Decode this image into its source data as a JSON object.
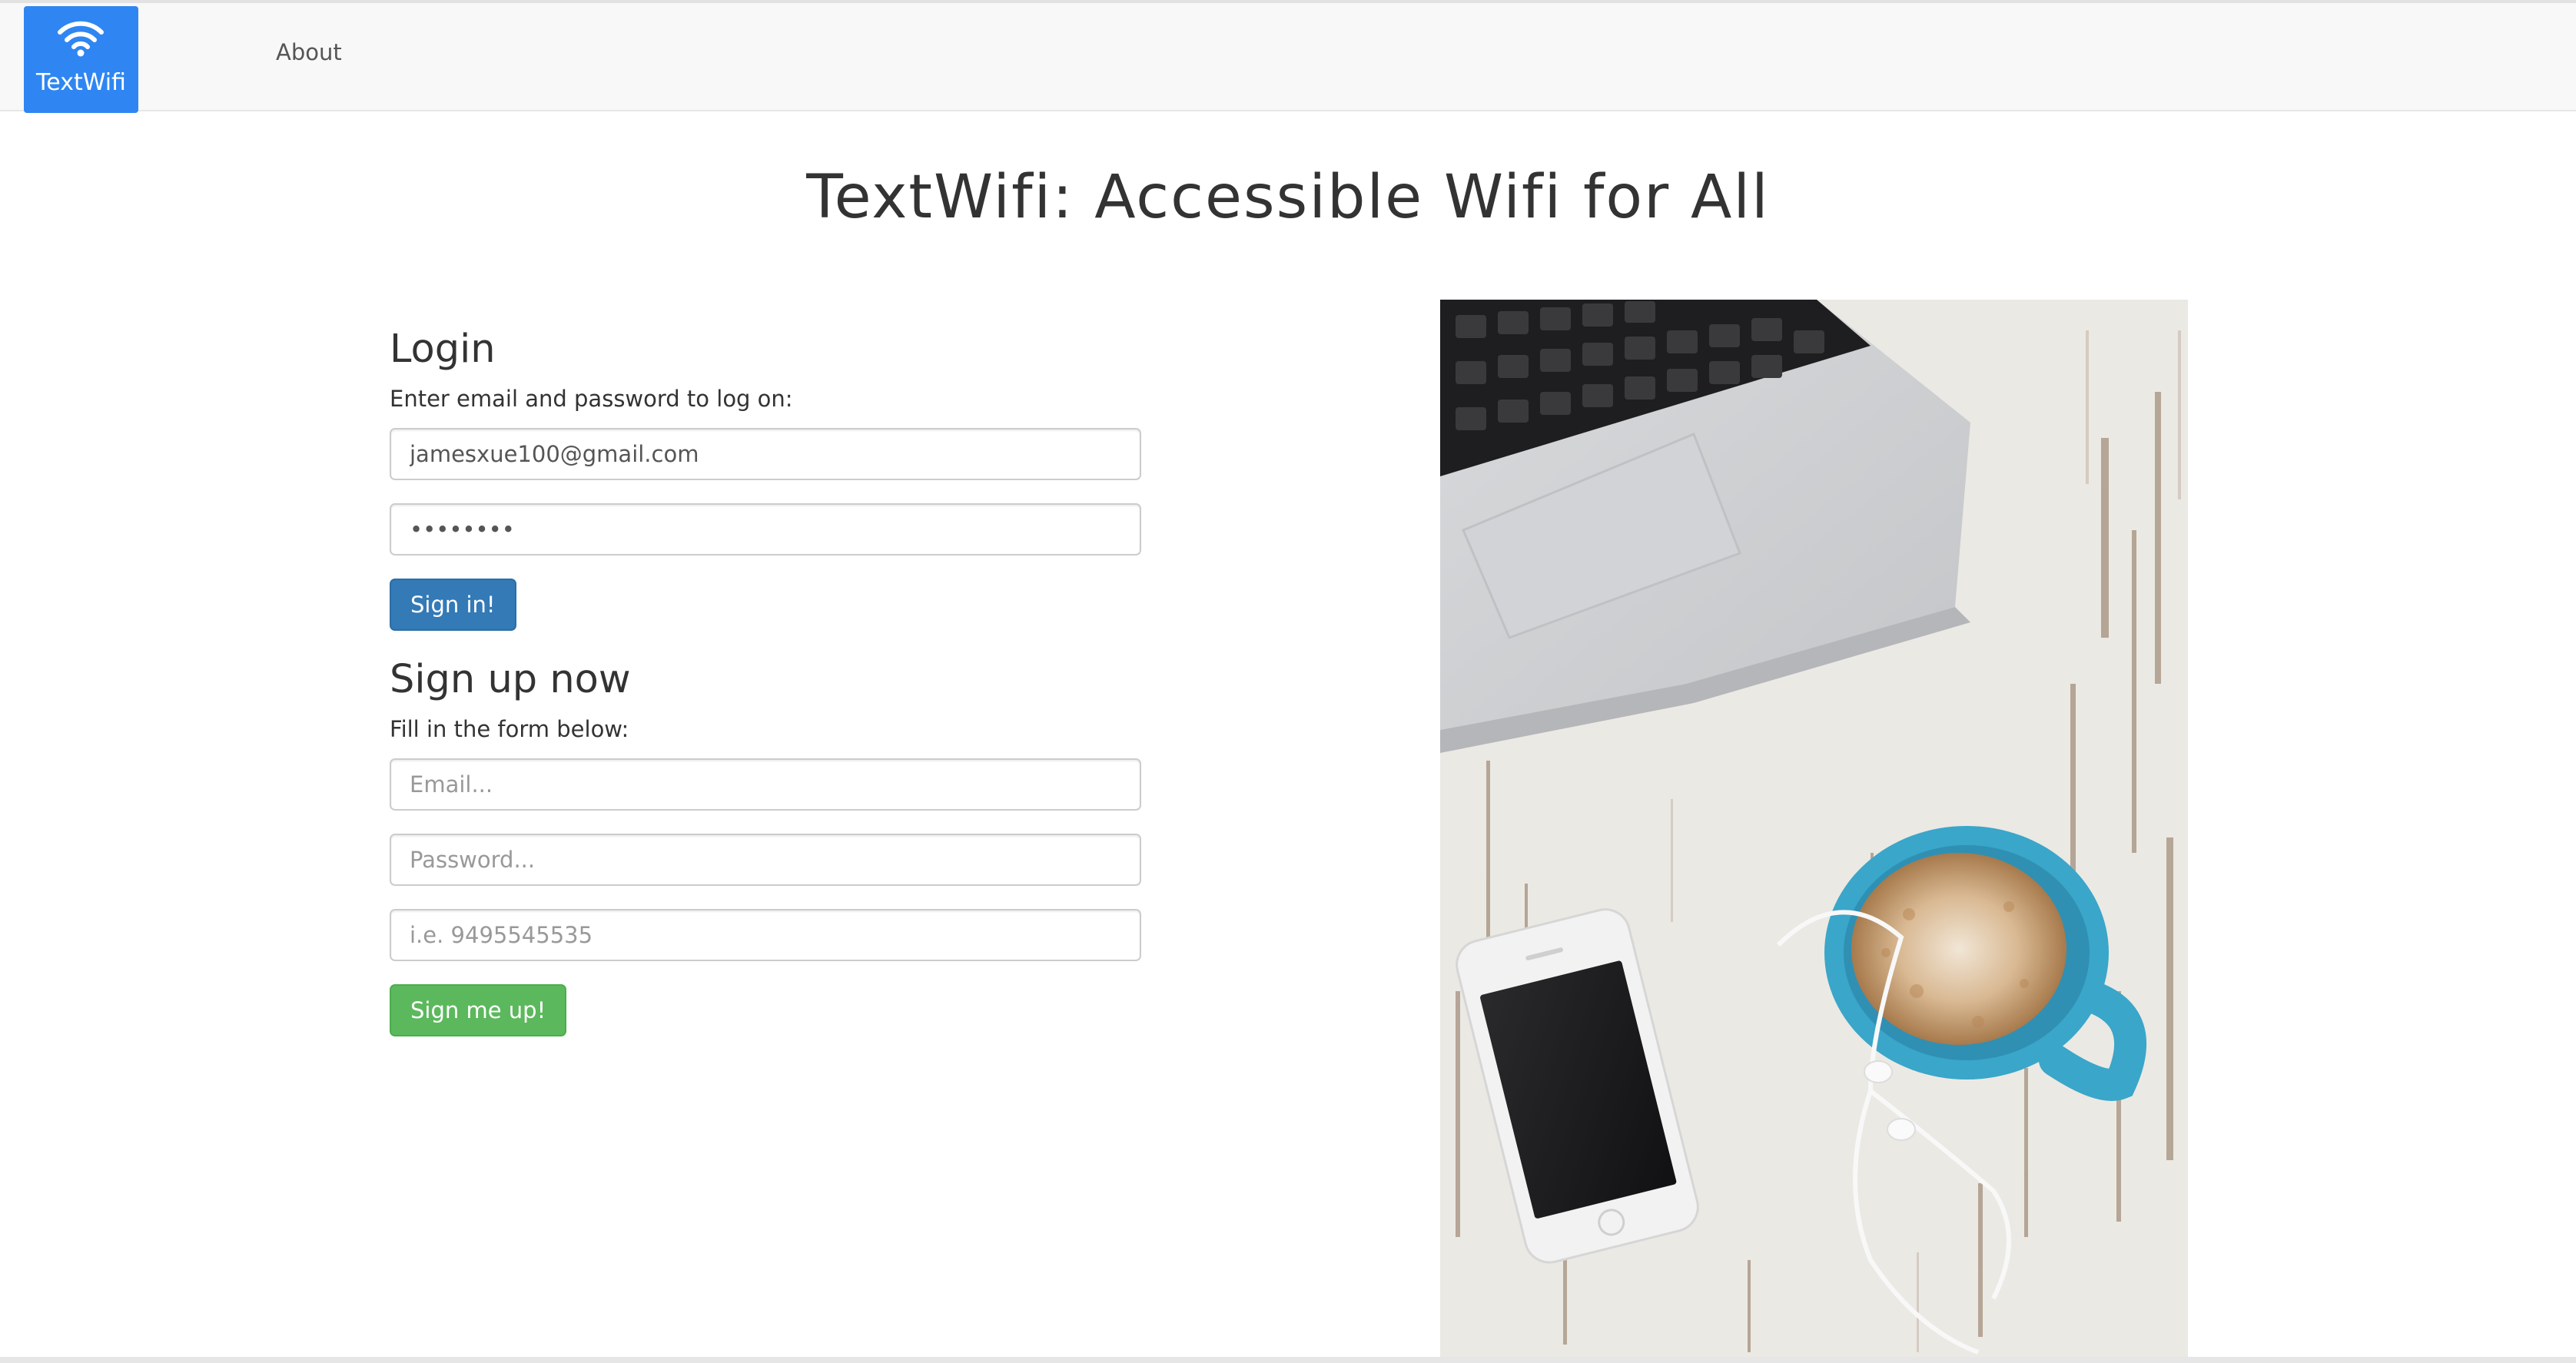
{
  "navbar": {
    "brand_label": "TextWifi",
    "brand_icon": "wifi-icon",
    "about_label": "About"
  },
  "page": {
    "title": "TextWifi: Accessible Wifi for All"
  },
  "login": {
    "heading": "Login",
    "subtitle": "Enter email and password to log on:",
    "email_value": "jamesxue100@gmail.com",
    "password_value": "password",
    "button_label": "Sign in!"
  },
  "signup": {
    "heading": "Sign up now",
    "subtitle": "Fill in the form below:",
    "email_placeholder": "Email...",
    "password_placeholder": "Password...",
    "phone_placeholder": "i.e. 9495545535",
    "button_label": "Sign me up!"
  },
  "colors": {
    "brand": "#2f86f2",
    "primary_button": "#337ab7",
    "success_button": "#5cb85c",
    "navbar_bg": "#f8f8f8"
  }
}
